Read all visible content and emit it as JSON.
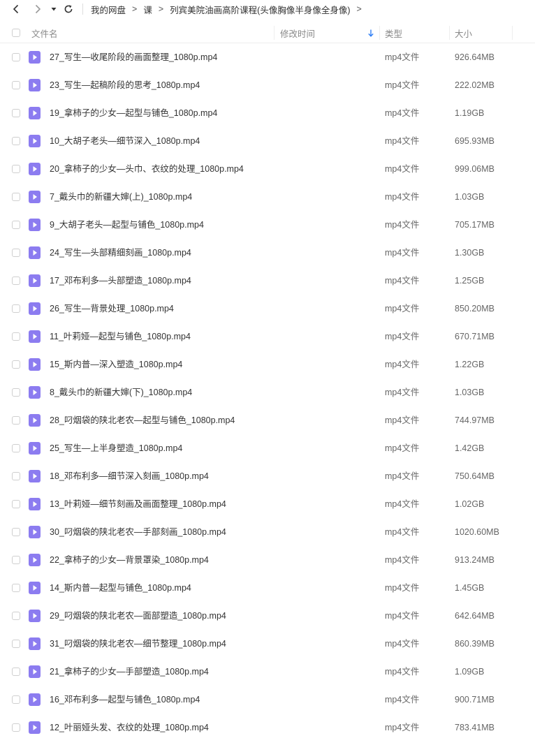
{
  "breadcrumb": {
    "root": "我的网盘",
    "items": [
      "课",
      "列宾美院油画高阶课程(头像胸像半身像全身像)"
    ],
    "arrow": ">"
  },
  "columns": {
    "name": "文件名",
    "modified": "修改时间",
    "type": "类型",
    "size": "大小"
  },
  "colors": {
    "icon_bg": "#8c7cf0",
    "sort_arrow": "#2f7ef5"
  },
  "files": [
    {
      "name": "27_写生—收尾阶段的画面整理_1080p.mp4",
      "type": "mp4文件",
      "size": "926.64MB"
    },
    {
      "name": "23_写生—起稿阶段的思考_1080p.mp4",
      "type": "mp4文件",
      "size": "222.02MB"
    },
    {
      "name": "19_拿柿子的少女—起型与铺色_1080p.mp4",
      "type": "mp4文件",
      "size": "1.19GB"
    },
    {
      "name": "10_大胡子老头—细节深入_1080p.mp4",
      "type": "mp4文件",
      "size": "695.93MB"
    },
    {
      "name": "20_拿柿子的少女—头巾、衣纹的处理_1080p.mp4",
      "type": "mp4文件",
      "size": "999.06MB"
    },
    {
      "name": "7_戴头巾的新疆大婶(上)_1080p.mp4",
      "type": "mp4文件",
      "size": "1.03GB"
    },
    {
      "name": "9_大胡子老头—起型与铺色_1080p.mp4",
      "type": "mp4文件",
      "size": "705.17MB"
    },
    {
      "name": "24_写生—头部精细刻画_1080p.mp4",
      "type": "mp4文件",
      "size": "1.30GB"
    },
    {
      "name": "17_邓布利多—头部塑造_1080p.mp4",
      "type": "mp4文件",
      "size": "1.25GB"
    },
    {
      "name": "26_写生—背景处理_1080p.mp4",
      "type": "mp4文件",
      "size": "850.20MB"
    },
    {
      "name": "11_叶莉娅—起型与铺色_1080p.mp4",
      "type": "mp4文件",
      "size": "670.71MB"
    },
    {
      "name": "15_斯内普—深入塑造_1080p.mp4",
      "type": "mp4文件",
      "size": "1.22GB"
    },
    {
      "name": "8_戴头巾的新疆大婶(下)_1080p.mp4",
      "type": "mp4文件",
      "size": "1.03GB"
    },
    {
      "name": "28_叼烟袋的陕北老农—起型与铺色_1080p.mp4",
      "type": "mp4文件",
      "size": "744.97MB"
    },
    {
      "name": "25_写生—上半身塑造_1080p.mp4",
      "type": "mp4文件",
      "size": "1.42GB"
    },
    {
      "name": "18_邓布利多—细节深入刻画_1080p.mp4",
      "type": "mp4文件",
      "size": "750.64MB"
    },
    {
      "name": "13_叶莉娅—细节刻画及画面整理_1080p.mp4",
      "type": "mp4文件",
      "size": "1.02GB"
    },
    {
      "name": "30_叼烟袋的陕北老农—手部刻画_1080p.mp4",
      "type": "mp4文件",
      "size": "1020.60MB"
    },
    {
      "name": "22_拿柿子的少女—背景罩染_1080p.mp4",
      "type": "mp4文件",
      "size": "913.24MB"
    },
    {
      "name": "14_斯内普—起型与铺色_1080p.mp4",
      "type": "mp4文件",
      "size": "1.45GB"
    },
    {
      "name": "29_叼烟袋的陕北老农—面部塑造_1080p.mp4",
      "type": "mp4文件",
      "size": "642.64MB"
    },
    {
      "name": "31_叼烟袋的陕北老农—细节整理_1080p.mp4",
      "type": "mp4文件",
      "size": "860.39MB"
    },
    {
      "name": "21_拿柿子的少女—手部塑造_1080p.mp4",
      "type": "mp4文件",
      "size": "1.09GB"
    },
    {
      "name": "16_邓布利多—起型与铺色_1080p.mp4",
      "type": "mp4文件",
      "size": "900.71MB"
    },
    {
      "name": "12_叶丽娅头发、衣纹的处理_1080p.mp4",
      "type": "mp4文件",
      "size": "783.41MB"
    }
  ]
}
